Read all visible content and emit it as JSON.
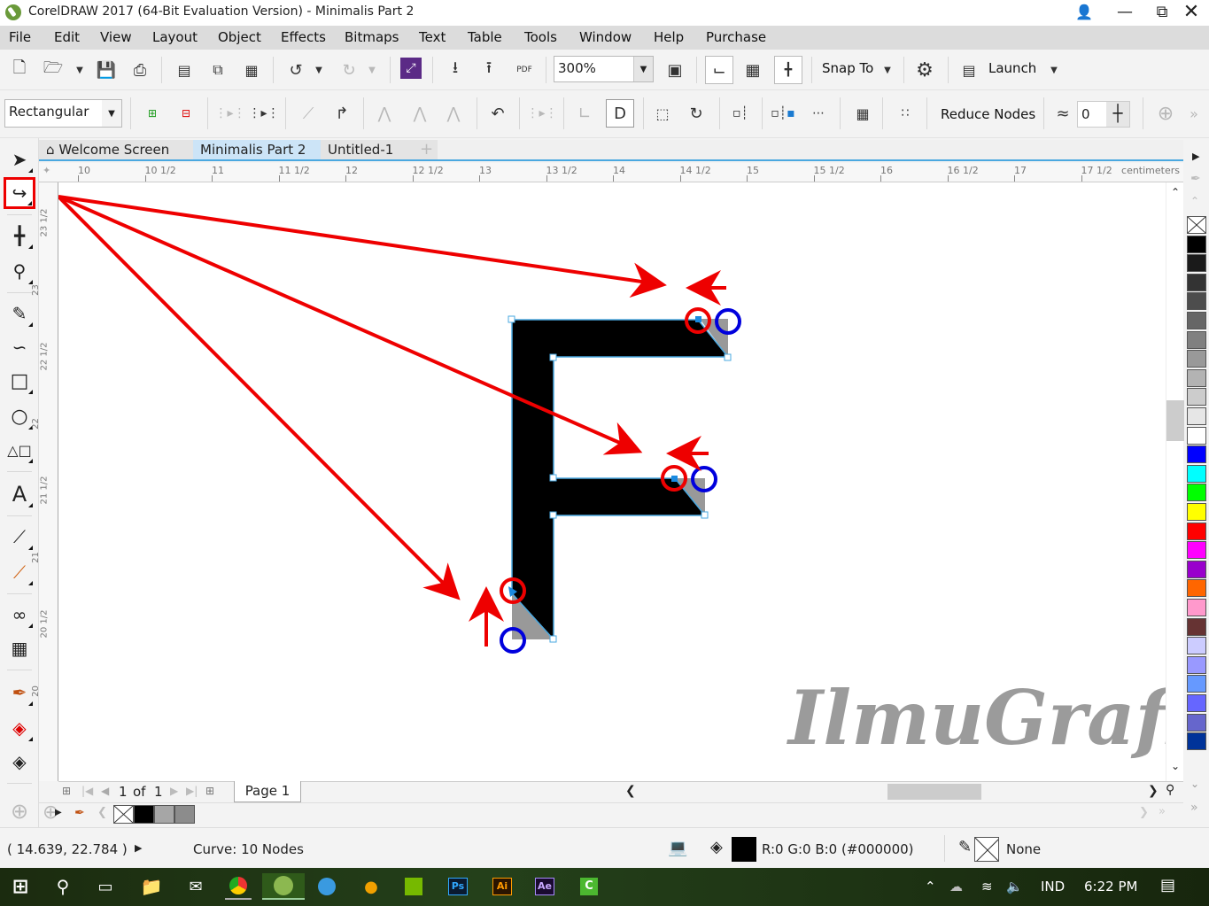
{
  "window": {
    "title": "CorelDRAW 2017 (64-Bit Evaluation Version) - Minimalis Part 2",
    "controls": [
      "account-icon",
      "minimize",
      "restore",
      "close"
    ]
  },
  "menu": [
    "File",
    "Edit",
    "View",
    "Layout",
    "Object",
    "Effects",
    "Bitmaps",
    "Text",
    "Table",
    "Tools",
    "Window",
    "Help",
    "Purchase"
  ],
  "standard_toolbar": {
    "zoom_level": "300%",
    "snap_to_label": "Snap To",
    "launch_label": "Launch",
    "icons": [
      "new-document",
      "open",
      "save",
      "print",
      "cut",
      "copy",
      "paste",
      "undo",
      "redo",
      "search-content",
      "import",
      "export",
      "publish-pdf",
      "full-screen",
      "show-rulers",
      "show-grid",
      "show-guidelines",
      "options"
    ]
  },
  "property_bar": {
    "selection_mode": "Rectangular",
    "reduce_nodes_label": "Reduce Nodes",
    "curve_smoothness": "0",
    "icons": [
      "add-node",
      "delete-node",
      "join-nodes",
      "break-curve",
      "to-line",
      "to-curve",
      "cusp-node",
      "smooth-node",
      "symmetrical-node",
      "reverse-direction",
      "extract-subpath",
      "extend-curve-to-close",
      "close-curve",
      "stretch-scale-nodes",
      "rotate-skew-nodes",
      "align-nodes",
      "reflect-horizontal",
      "reflect-vertical",
      "elastic-mode",
      "select-all-nodes"
    ]
  },
  "doc_tabs": [
    {
      "label": "Welcome Screen",
      "active": false,
      "icon": "home-icon"
    },
    {
      "label": "Minimalis Part 2",
      "active": true
    },
    {
      "label": "Untitled-1",
      "active": false
    }
  ],
  "rulers": {
    "horizontal_labels": [
      "10",
      "10 1/2",
      "11",
      "11 1/2",
      "12",
      "12 1/2",
      "13",
      "13 1/2",
      "14",
      "14 1/2",
      "15",
      "15 1/2",
      "16",
      "16 1/2",
      "17",
      "17 1/2"
    ],
    "units": "centimeters",
    "vertical_labels": [
      "23 1/2",
      "23",
      "22 1/2",
      "22",
      "21 1/2",
      "21",
      "20 1/2",
      "20"
    ]
  },
  "toolbox": [
    "pick",
    "shape",
    "crop",
    "zoom",
    "freehand",
    "artistic-media",
    "rectangle",
    "ellipse",
    "polygon",
    "text",
    "parallel-dimension",
    "connector",
    "blend",
    "transparency",
    "color-eyedropper",
    "interactive-fill",
    "smart-fill"
  ],
  "toolbox_active": "shape",
  "canvas": {
    "watermark": "IlmuGrafika.id",
    "object": "F letter curve",
    "highlight_color": "#ff0000",
    "marker_color": "#0000dd"
  },
  "page_nav": {
    "current": "1",
    "of_label": "of",
    "total": "1",
    "page_tab": "Page 1"
  },
  "color_palette": [
    "none",
    "#000000",
    "#1a1a1a",
    "#333333",
    "#4d4d4d",
    "#666666",
    "#808080",
    "#999999",
    "#b3b3b3",
    "#cccccc",
    "#e6e6e6",
    "#ffffff",
    "#0000ff",
    "#00ffff",
    "#00ff00",
    "#ffff00",
    "#ff0000",
    "#ff00ff",
    "#9900cc",
    "#ff6600",
    "#ff99cc",
    "#663333",
    "#ccccff",
    "#9999ff",
    "#6699ff",
    "#6666ff",
    "#6666cc",
    "#003399"
  ],
  "document_palette": [
    "none",
    "#000000",
    "#a6a6a6",
    "#8c8c8c"
  ],
  "status": {
    "coordinates": "( 14.639, 22.784 )",
    "object_info": "Curve: 10 Nodes",
    "fill_text": "R:0 G:0 B:0 (#000000)",
    "fill_color": "#000000",
    "outline_text": "None"
  },
  "taskbar": {
    "apps": [
      "start",
      "search",
      "task-view",
      "file-explorer",
      "mail",
      "chrome",
      "coreldraw",
      "app-blue",
      "fl-studio",
      "nvidia",
      "photoshop",
      "illustrator",
      "after-effects",
      "camtasia"
    ],
    "app_labels": {
      "ps": "Ps",
      "ai": "Ai",
      "ae": "Ae",
      "cam": "C"
    },
    "language": "IND",
    "time": "6:22 PM"
  }
}
